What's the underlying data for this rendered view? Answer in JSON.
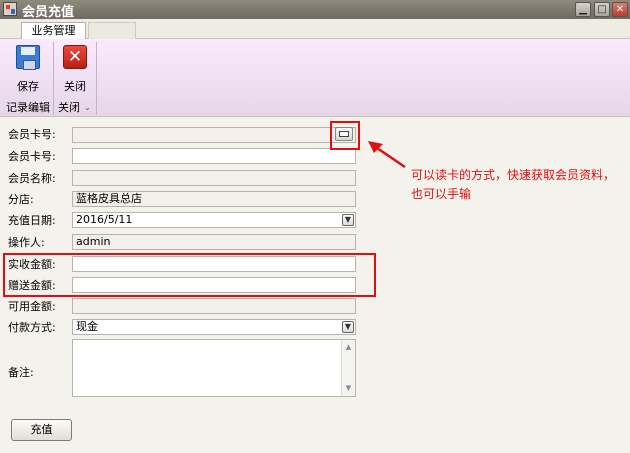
{
  "window": {
    "title": "会员充值",
    "minimize_icon": "minimize-icon",
    "maximize_icon": "maximize-icon",
    "close_icon": "close-icon"
  },
  "tabs": [
    {
      "label": "业务管理",
      "selected": true
    }
  ],
  "ribbon": {
    "save_label": "保存",
    "close_label": "关闭",
    "group1_label": "记录编辑",
    "group2_label": "关闭",
    "save_icon": "floppy-disk-icon",
    "close_icon": "red-x-icon"
  },
  "form": {
    "card_no_read_label": "会员卡号:",
    "card_no_read_value": "",
    "card_no_label": "会员卡号:",
    "card_no_value": "",
    "member_name_label": "会员名称:",
    "member_name_value": "",
    "branch_label": "分店:",
    "branch_value": "蓝格皮具总店",
    "date_label": "充值日期:",
    "date_value": "2016/5/11",
    "operator_label": "操作人:",
    "operator_value": "admin",
    "received_label": "实收金额:",
    "received_value": "",
    "bonus_label": "赠送金额:",
    "bonus_value": "",
    "available_label": "可用金额:",
    "available_value": "",
    "payment_label": "付款方式:",
    "payment_value": "现金",
    "remark_label": "备注:",
    "remark_value": "",
    "submit_label": "充值"
  },
  "annotation": {
    "text": "可以读卡的方式，快速获取会员资料，也可以手输",
    "color": "#e01010"
  }
}
